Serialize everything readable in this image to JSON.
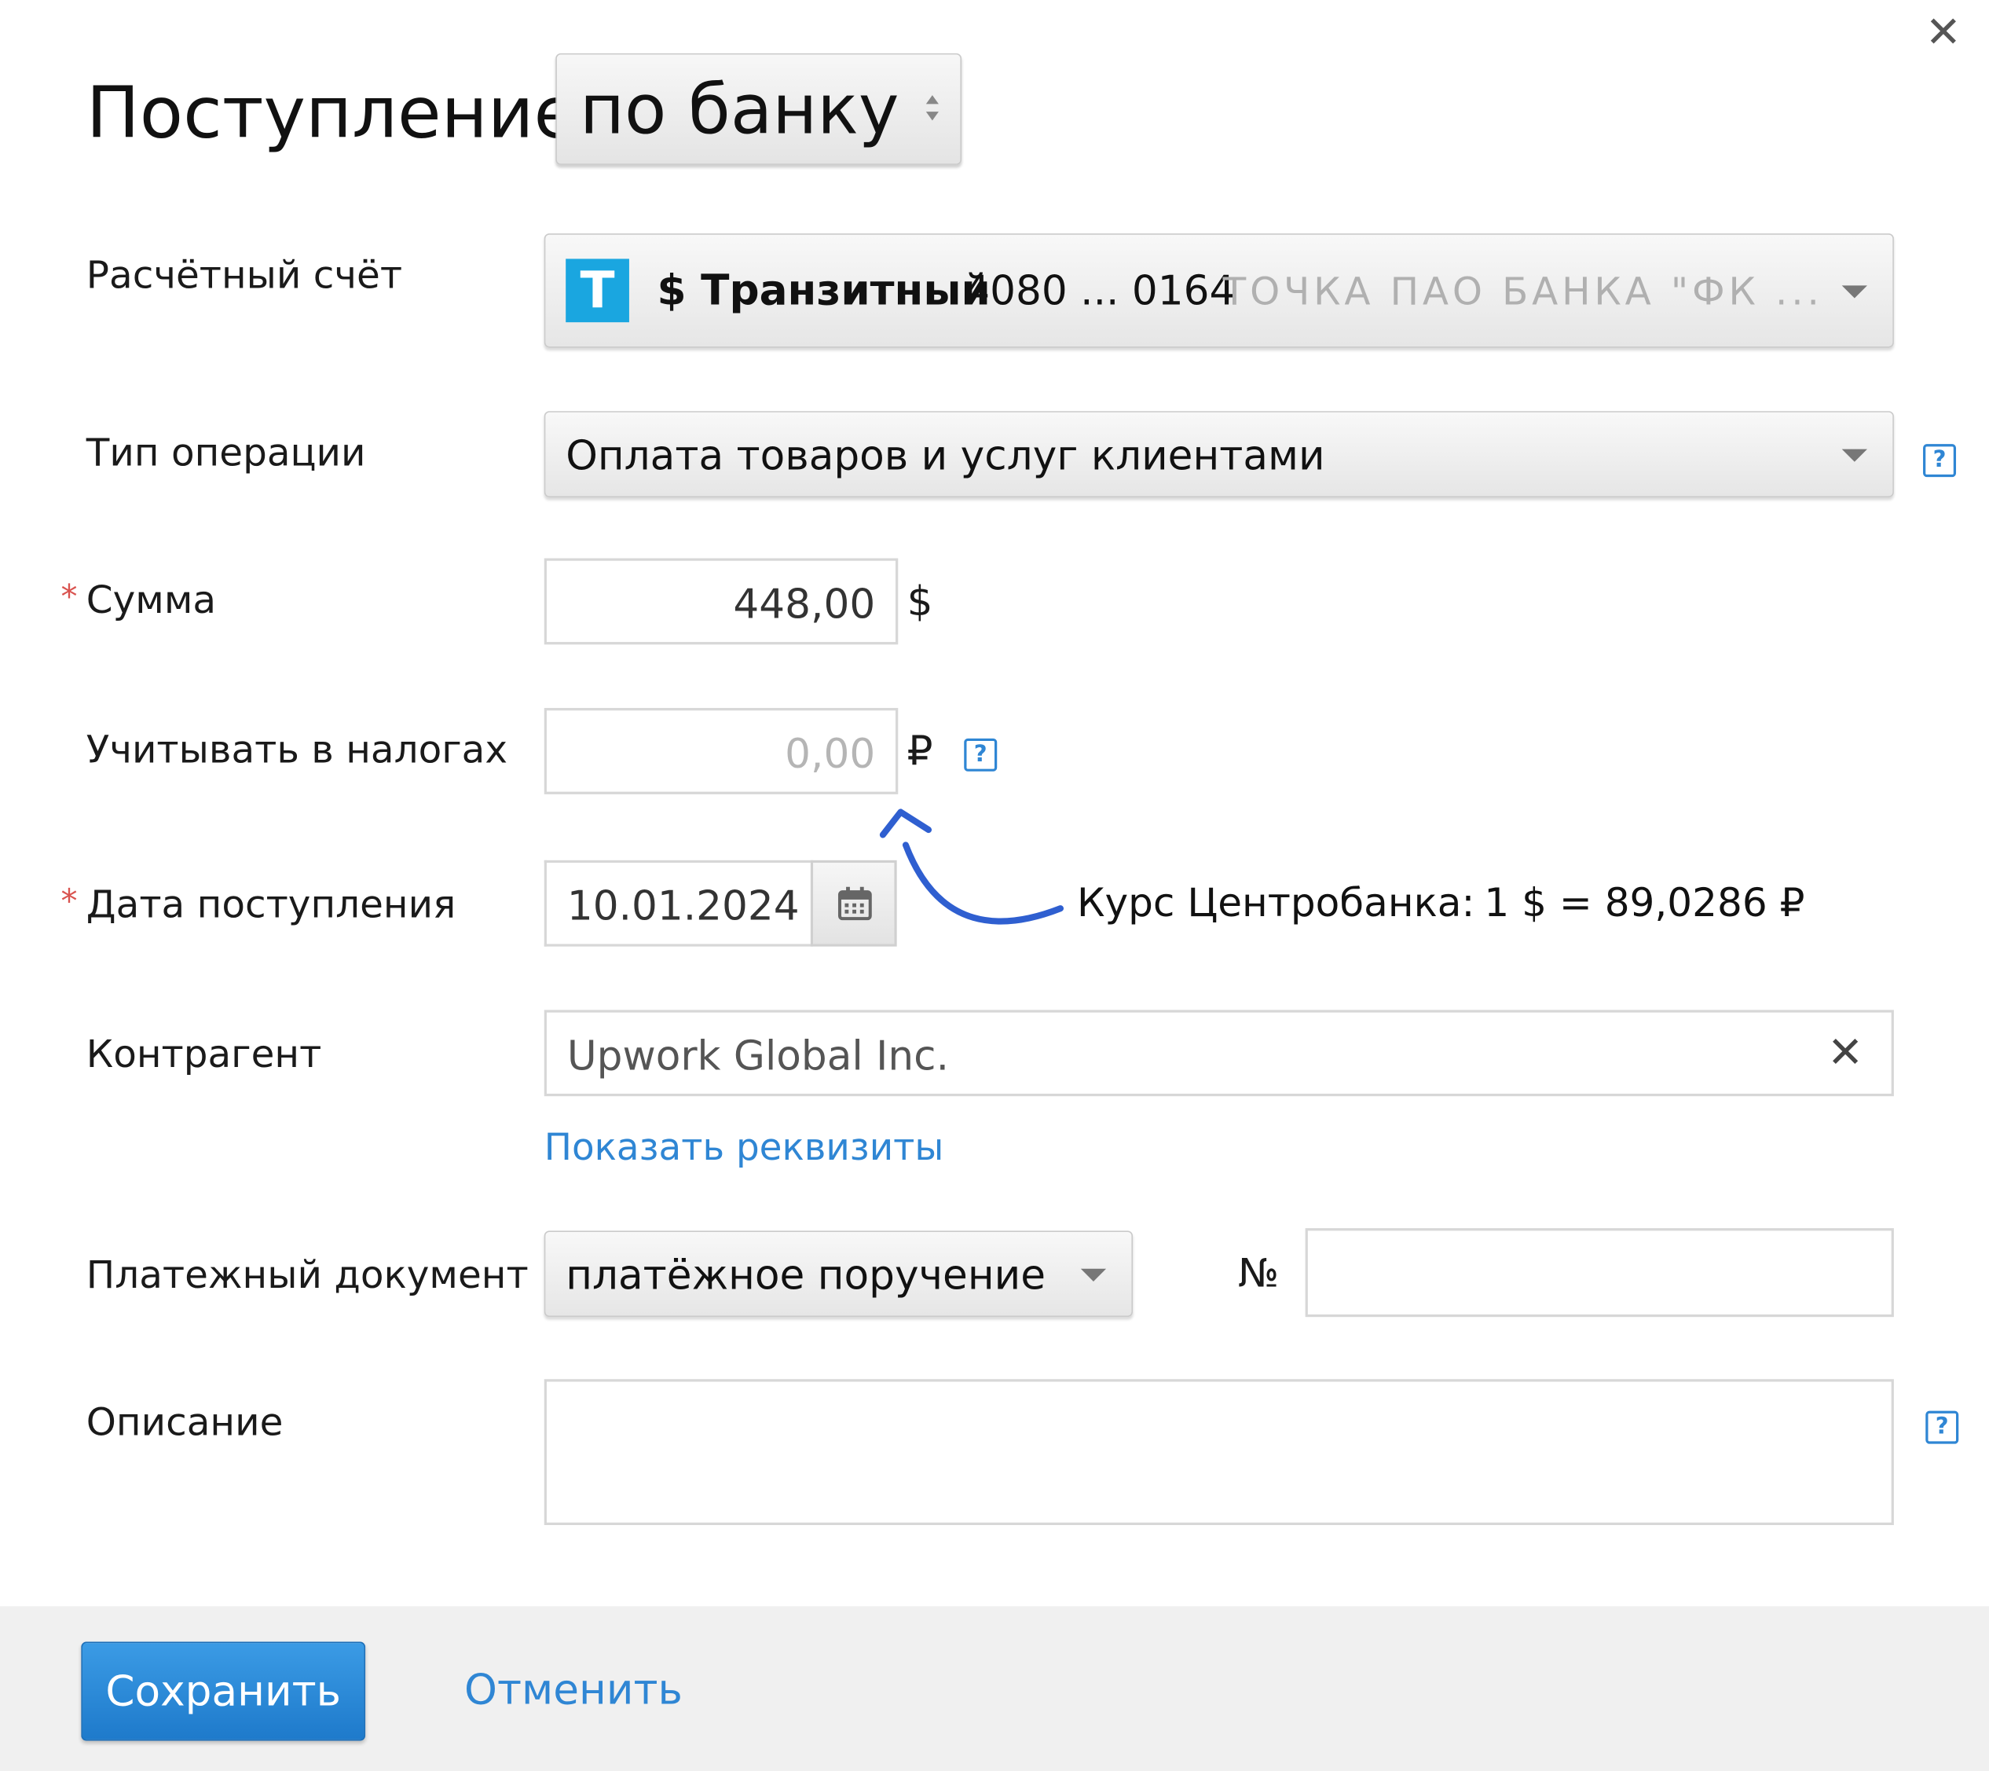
{
  "header": {
    "title": "Поступление",
    "type_value": "по банку",
    "close_symbol": "✕"
  },
  "fields": {
    "account": {
      "label": "Расчётный счёт",
      "bank_logo_letter": "Т",
      "name": "$ Транзитный",
      "number": "4080 ... 0164",
      "bank": "ТОЧКА ПАО БАНКА \"ФК ..."
    },
    "operation_type": {
      "label": "Тип операции",
      "value": "Оплата товаров и услуг клиентами"
    },
    "amount": {
      "label": "Сумма",
      "required_mark": "*",
      "value": "448,00",
      "currency": "$"
    },
    "tax": {
      "label": "Учитывать в налогах",
      "placeholder": "0,00",
      "currency": "₽"
    },
    "date": {
      "label": "Дата поступления",
      "required_mark": "*",
      "value": "10.01.2024"
    },
    "rate": {
      "label": "Курс Центробанка:",
      "value": "1 $ = 89,0286 ₽"
    },
    "contractor": {
      "label": "Контрагент",
      "value": "Upwork Global Inc.",
      "clear_symbol": "✕",
      "details_link": "Показать реквизиты"
    },
    "payment_doc": {
      "label": "Платежный документ",
      "value": "платёжное поручение",
      "number_label": "№",
      "number_value": ""
    },
    "description": {
      "label": "Описание",
      "value": ""
    }
  },
  "help_symbol": "?",
  "footer": {
    "save_label": "Сохранить",
    "cancel_label": "Отменить"
  },
  "colors": {
    "accent": "#2f86d4",
    "primary_button": "#1e7acb",
    "bank_logo": "#1aa6e0",
    "required": "#d9534f",
    "annotation_arrow": "#2f5fd0"
  }
}
